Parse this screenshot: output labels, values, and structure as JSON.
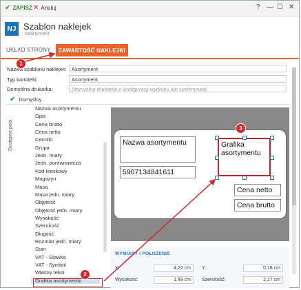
{
  "toolbar": {
    "save_label": "ZAPISZ",
    "cancel_label": "Anuluj"
  },
  "window_controls": {
    "help": "?",
    "minimize": "—",
    "maximize": "☐",
    "close": "✕"
  },
  "header": {
    "badge": "NJ",
    "title": "Szablon naklejek",
    "subtitle": "Asortyment"
  },
  "tabs": [
    {
      "label": "UKŁAD STRONY"
    },
    {
      "label": "ZAWARTOŚĆ NAKLEJKI"
    }
  ],
  "form": {
    "name_label": "Nazwa szablonu naklejek:",
    "name_value": "Asortyment",
    "type_label": "Typ kartoteki:",
    "type_value": "Asortyment",
    "printer_label": "Domyślna drukarka:",
    "printer_placeholder": "(domyślna drukarka z konfiguracji wydruku lub systemowa)",
    "default_label": "Domyślny"
  },
  "side_strip_label": "Dostępne pola",
  "fields_list": [
    "Nazwa asortymentu",
    "Opis",
    "Cena brutto",
    "Cena netto",
    "Cenniki",
    "Grupa",
    "Jedn. miary",
    "Jedn. porównawcza",
    "Kod kreskowy",
    "Magazyn",
    "Masa",
    "Masa jedn. miary",
    "Objętość",
    "Objętość jedn. miary",
    "Wysokość",
    "Szerokość",
    "Długość",
    "Rozmiar jedn. miary",
    "Stan",
    "VAT - Stawka",
    "VAT - Symbol",
    "Własny tekst",
    "Grafika asortymentu"
  ],
  "canvas_elements": {
    "nazwa": "Nazwa asortymentu",
    "ean": "5907134841611",
    "grafika": "Grafika asortymentu",
    "cena_netto": "Cena netto",
    "cena_brutto": "Cena brutto"
  },
  "dimensions": {
    "title": "WYMIARY I POŁOŻENIE",
    "x_label": "X:",
    "x_value": "4,22 cm",
    "y_label": "Y:",
    "y_value": "0,18 cm",
    "h_label": "Wysokość:",
    "h_value": "1,49 cm",
    "w_label": "Szerokość:",
    "w_value": "2,17 cm"
  },
  "annotations": {
    "badge1": "1",
    "badge2": "2",
    "badge3": "3"
  },
  "colors": {
    "accent": "#e8622a",
    "brand": "#1f73b7",
    "annotation": "#d9232d"
  }
}
